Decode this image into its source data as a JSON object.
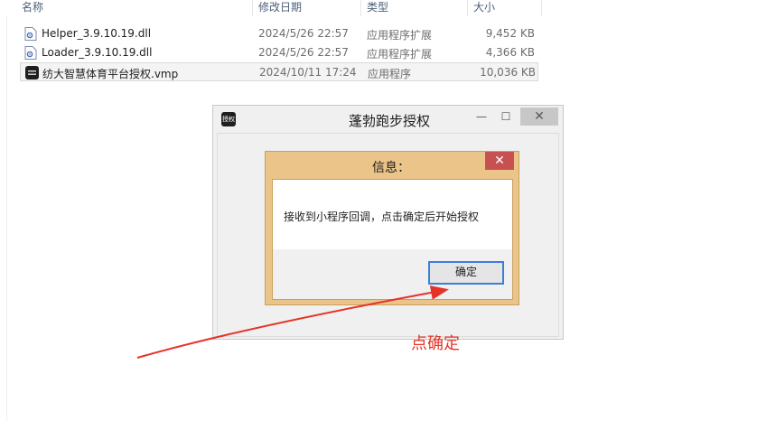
{
  "explorer": {
    "columns": {
      "name": "名称",
      "date": "修改日期",
      "type": "类型",
      "size": "大小"
    },
    "files": [
      {
        "name": "Helper_3.9.10.19.dll",
        "date": "2024/5/26 22:57",
        "type": "应用程序扩展",
        "size": "9,452 KB",
        "icon": "dll-file-icon"
      },
      {
        "name": "Loader_3.9.10.19.dll",
        "date": "2024/5/26 22:57",
        "type": "应用程序扩展",
        "size": "4,366 KB",
        "icon": "dll-file-icon"
      },
      {
        "name": "纺大智慧体育平台授权.vmp",
        "date": "2024/10/11 17:24",
        "type": "应用程序",
        "size": "10,036 KB",
        "icon": "app-icon"
      }
    ]
  },
  "window": {
    "title": "蓬勃跑步授权",
    "icon_text": "授权",
    "close_glyph": "✕",
    "min_glyph": "—",
    "max_glyph": "☐"
  },
  "dialog": {
    "title": "信息：",
    "message": "接收到小程序回调，点击确定后开始授权",
    "ok_label": "确定",
    "close_glyph": "✕"
  },
  "annotation": {
    "text": "点确定",
    "color": "#e53329"
  }
}
